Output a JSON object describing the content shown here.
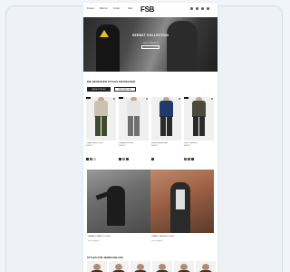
{
  "nav": {
    "links": [
      "Frauen",
      "Männer",
      "Kinder",
      "Sale"
    ],
    "logo": "FSB",
    "icons": [
      "search-icon",
      "heart-icon",
      "user-icon",
      "bag-icon"
    ]
  },
  "hero": {
    "headline": "HERBST KOLLEKTION",
    "subtitle": "Jetzt entdecken",
    "cta_label": ""
  },
  "new_in": {
    "title": "DIE NEUESTEN STYLES ENTDECKEN",
    "filters": [
      "NEUE STYLES",
      "BESTSELLER"
    ],
    "active_filter": "NEUE STYLES"
  },
  "products": [
    {
      "name": "Cargo Shorts Olive",
      "price": "49,95 €",
      "swatches": [
        "#2a2a2a",
        "#6b6b4a",
        "#c9c9c9"
      ],
      "torso": "#c9c2b0",
      "legs": "#3e4a2e"
    },
    {
      "name": "Cargohose Grau",
      "price": "79,95 €",
      "swatches": [
        "#2a2a2a",
        "#8a8a8a",
        "#3e3e3e"
      ],
      "torso": "#e5e5e5",
      "legs": "#6f6f6f"
    },
    {
      "name": "Denim Hemd Blau",
      "price": "59,95 €",
      "swatches": [
        "#1f3a6b"
      ],
      "torso": "#1f3a6b",
      "legs": "#2a2a2a"
    },
    {
      "name": "Karo Overshirt",
      "price": "69,95 €",
      "swatches": [
        "#5a6a4a",
        "#7a4a3a",
        "#3a3a3a"
      ],
      "torso": "#4a4a3a",
      "legs": "#2a2a2a"
    }
  ],
  "lookbook": [
    {
      "caption": "URBAN STREET LOOKS",
      "sub": "Jetzt shoppen"
    },
    {
      "caption": "SMART CASUAL LOOKS",
      "sub": "Jetzt shoppen"
    }
  ],
  "bottom": {
    "title": "STYLES FÜR JEDEN ANLASS"
  }
}
